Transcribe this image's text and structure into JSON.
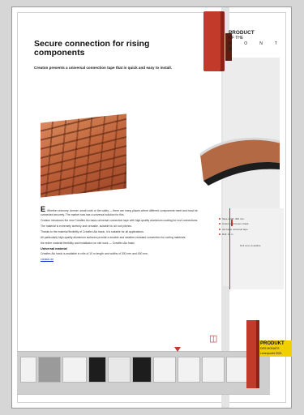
{
  "article": {
    "title": "Secure connection for rising components",
    "subtitle": "Creaton presents a universal connection tape that is quick and easy to install."
  },
  "badge": {
    "line1": "PRODUCT",
    "line2": "OF THE",
    "month_letters": [
      "M",
      "O",
      "N",
      "T"
    ],
    "line4": "H"
  },
  "badge_bottom": {
    "line1": "PRODUKT",
    "line2": "DES MONATS",
    "line3": "Leserpunkt 2021"
  },
  "body": {
    "dropcap": "E",
    "para1": "Whether chimney, dormer, small roofs or the valley — there are many places where different components meet and must be connected securely. The market now has a universal solution for this.",
    "para2": "Creaton introduces the new Creaflex Alu basic universal connection tape with high-quality aluminium coating for roof connections.",
    "para3": "The material is extremely stretchy and versatile, suitable for all roof pitches.",
    "para4": "Thanks to the material flexibility of Creaflex Alu basic, it is suitable for all applications.",
    "para5": "All particularly high-quality aluminium surfaces provide a durable and weather-resistant connection for roofing materials.",
    "para6": "the entire material flexibility and installation on site work — Creaflex Alu basic.",
    "subhead": "Universal material",
    "para7": "Creaflex Alu basic is available in rolls of 10 m length and widths of 300 mm and 450 mm.",
    "link": "creaton.de"
  },
  "side_notes": [
    "Tape width: 300 mm",
    "Colour: red brown, black",
    "Alu basic universal tape",
    "Roll: 10 m"
  ],
  "box_note": "Roll sizes available"
}
